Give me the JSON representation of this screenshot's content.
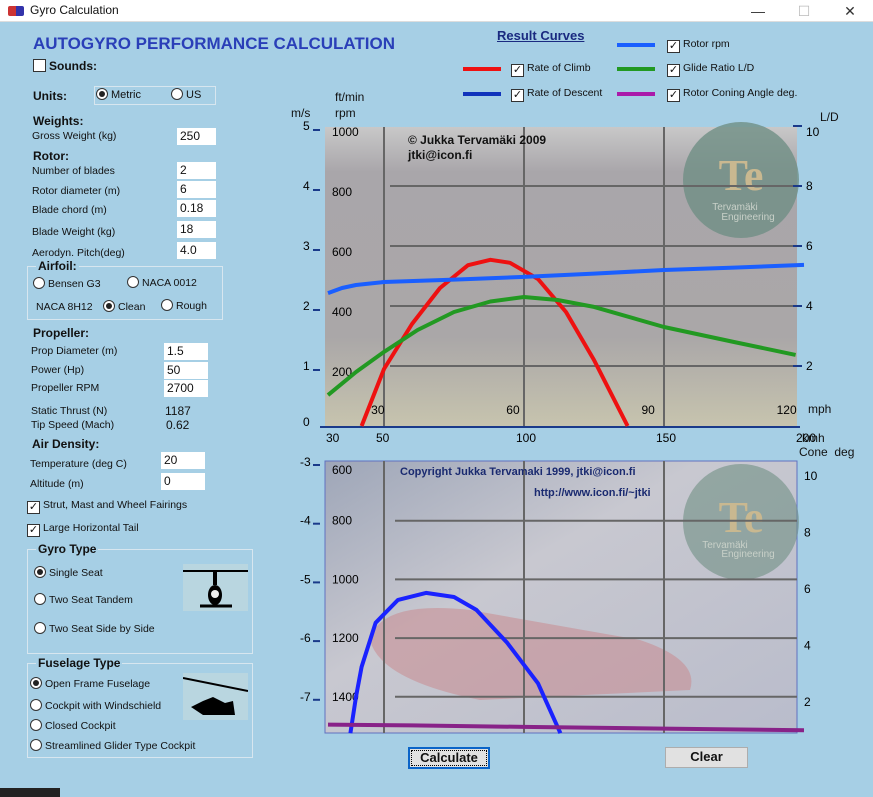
{
  "window": {
    "title": "Gyro Calculation",
    "minimize": "—",
    "maximize": "☐",
    "close": "✕"
  },
  "app": {
    "heading": "AUTOGYRO PERFORMANCE CALCULATION",
    "sounds_label": "Sounds:",
    "sounds_checked": false
  },
  "units": {
    "label": "Units:",
    "options": [
      "Metric",
      "US"
    ],
    "selected": "Metric"
  },
  "weights": {
    "header": "Weights:",
    "gross_weight_label": "Gross Weight (kg)",
    "gross_weight": "250"
  },
  "rotor": {
    "header": "Rotor:",
    "fields": [
      {
        "label": "Number of blades",
        "value": "2"
      },
      {
        "label": "Rotor diameter (m)",
        "value": "6"
      },
      {
        "label": "Blade chord  (m)",
        "value": "0.18"
      },
      {
        "label": "Blade Weight (kg)",
        "value": "18"
      },
      {
        "label": "Aerodyn. Pitch(deg)",
        "value": "4.0"
      }
    ]
  },
  "airfoil": {
    "header": "Airfoil:",
    "bensen": "Bensen G3",
    "naca0012": "NACA 0012",
    "naca8h12": "NACA 8H12",
    "clean": "Clean",
    "rough": "Rough",
    "selected": "Clean"
  },
  "propeller": {
    "header": "Propeller:",
    "fields": [
      {
        "label": "Prop Diameter (m)",
        "value": "1.5"
      },
      {
        "label": "Power (Hp)",
        "value": "50"
      },
      {
        "label": "Propeller RPM",
        "value": "2700"
      }
    ],
    "static_thrust_label": "Static Thrust (N)",
    "static_thrust": "1187",
    "tip_speed_label": "Tip Speed (Mach)",
    "tip_speed": "0.62"
  },
  "air": {
    "header": "Air Density:",
    "temperature_label": "Temperature (deg C)",
    "temperature": "20",
    "altitude_label": "Altitude  (m)",
    "altitude": "0"
  },
  "options": {
    "fairings": "Strut, Mast and Wheel Fairings",
    "fairings_checked": true,
    "tail": "Large Horizontal Tail",
    "tail_checked": true
  },
  "gyro_type": {
    "header": "Gyro Type",
    "options": [
      "Single Seat",
      "Two Seat Tandem",
      "Two Seat Side by Side"
    ],
    "selected": "Single Seat"
  },
  "fuselage_type": {
    "header": "Fuselage Type",
    "options": [
      "Open Frame Fuselage",
      "Cockpit with Windschield",
      "Closed Cockpit",
      "Streamlined Glider Type Cockpit"
    ],
    "selected": "Open Frame Fuselage"
  },
  "legend": {
    "title": "Result Curves",
    "items": [
      {
        "label": "Rotor rpm",
        "color": "#1a5fff",
        "checked": true
      },
      {
        "label": "Rate of Climb",
        "color": "#ee1111",
        "checked": true
      },
      {
        "label": "Glide Ratio L/D",
        "color": "#229922",
        "checked": true
      },
      {
        "label": "Rate of Descent",
        "color": "#1133cc",
        "checked": true
      },
      {
        "label": "Rotor Coning Angle deg.",
        "color": "#992299",
        "checked": true
      }
    ]
  },
  "buttons": {
    "calculate": "Calculate",
    "clear": "Clear"
  },
  "chart_data": [
    {
      "type": "line",
      "axes": {
        "left1": "m/s",
        "left2": "ft/min",
        "left3": "rpm",
        "right": "L/D",
        "x_bottom": "kmh",
        "x_top": "mph"
      },
      "left_ticks": [
        "5",
        "4",
        "3",
        "2",
        "1",
        "0"
      ],
      "ftmin_ticks": [
        "1000",
        "800",
        "600",
        "400",
        "200"
      ],
      "ld_ticks": [
        "10",
        "8",
        "6",
        "4",
        "2"
      ],
      "mph_ticks": [
        "30",
        "60",
        "90",
        "120"
      ],
      "kmh_ticks": [
        "30",
        "50",
        "100",
        "150",
        "200"
      ],
      "xlim": [
        30,
        200
      ],
      "ylim_ms": [
        0,
        5
      ],
      "ylim_ld": [
        0,
        10
      ],
      "grid": true,
      "annotations": [
        "© Jukka Tervamäki 2009",
        "jtki@icon.fi"
      ],
      "series": [
        {
          "name": "Rate of Climb",
          "axis": "m/s",
          "color": "#ee1111",
          "x": [
            42,
            50,
            60,
            70,
            80,
            88,
            95,
            105,
            115,
            125,
            137
          ],
          "y": [
            0,
            0.95,
            1.7,
            2.3,
            2.68,
            2.77,
            2.72,
            2.45,
            1.9,
            1.1,
            0
          ]
        },
        {
          "name": "Rotor rpm",
          "axis": "rpm",
          "color": "#1a5fff",
          "x": [
            30,
            35,
            40,
            50,
            75,
            100,
            125,
            150,
            175,
            200
          ],
          "y": [
            443,
            460,
            470,
            480,
            488,
            497,
            508,
            520,
            528,
            537
          ]
        },
        {
          "name": "Glide Ratio L/D",
          "axis": "L/D",
          "color": "#229922",
          "x": [
            30,
            40,
            50,
            62,
            75,
            88,
            100,
            112,
            125,
            150,
            175,
            197
          ],
          "y": [
            1.03,
            1.8,
            2.47,
            3.2,
            3.8,
            4.15,
            4.3,
            4.2,
            3.97,
            3.3,
            2.8,
            2.37
          ]
        }
      ]
    },
    {
      "type": "line",
      "axes": {
        "left1": "m/s",
        "left2": "ft/min",
        "right": "Cone  deg"
      },
      "left_ticks": [
        "-3",
        "-4",
        "-5",
        "-6",
        "-7"
      ],
      "ftmin_ticks": [
        "600",
        "800",
        "1000",
        "1200",
        "1400"
      ],
      "cone_ticks": [
        "10",
        "8",
        "6",
        "4",
        "2"
      ],
      "xlim": [
        30,
        200
      ],
      "grid": true,
      "annotations": [
        "Copyright Jukka Tervamaki  1999, jtki@icon.fi",
        "http://www.icon.fi/~jtki"
      ],
      "series": [
        {
          "name": "Rate of Descent",
          "axis": "m/s",
          "color": "#1a22ff",
          "x": [
            38,
            40,
            42,
            47,
            55,
            65,
            75,
            83,
            94,
            105,
            113
          ],
          "y": [
            -7.62,
            -7.0,
            -6.49,
            -5.74,
            -5.35,
            -5.23,
            -5.3,
            -5.52,
            -6.08,
            -6.77,
            -7.62
          ]
        },
        {
          "name": "Rotor Coning Angle deg.",
          "axis": "deg",
          "color": "#882288",
          "x": [
            30,
            60,
            100,
            150,
            200
          ],
          "y": [
            1.2,
            1.17,
            1.12,
            1.06,
            1.0
          ]
        }
      ]
    }
  ]
}
